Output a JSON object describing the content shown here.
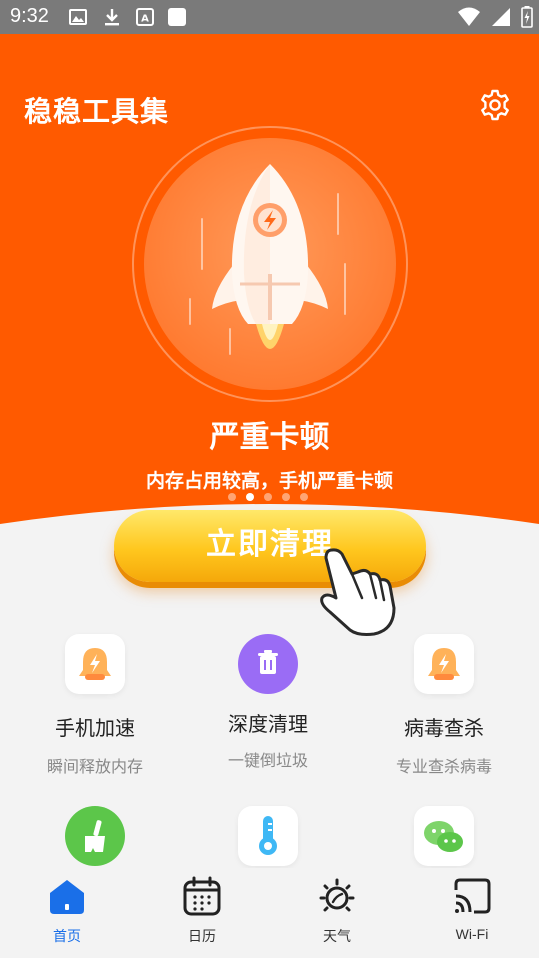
{
  "status_bar": {
    "time": "9:32"
  },
  "app": {
    "title": "稳稳工具集"
  },
  "hero": {
    "status_title": "严重卡顿",
    "status_desc": "内存占用较高，手机严重卡顿",
    "dots_total": 5,
    "dots_active": 2,
    "clean_button_label": "立即清理"
  },
  "tools": [
    {
      "name": "手机加速",
      "sub": "瞬间释放内存",
      "icon": "bell-bolt-icon"
    },
    {
      "name": "深度清理",
      "sub": "一键倒垃圾",
      "icon": "trash-icon"
    },
    {
      "name": "病毒查杀",
      "sub": "专业查杀病毒",
      "icon": "bell-bolt-icon"
    },
    {
      "name": "",
      "sub": "",
      "icon": "broom-icon"
    },
    {
      "name": "",
      "sub": "",
      "icon": "thermometer-icon"
    },
    {
      "name": "",
      "sub": "",
      "icon": "wechat-icon"
    }
  ],
  "nav": {
    "home": "首页",
    "calendar": "日历",
    "weather": "天气",
    "wifi": "Wi-Fi"
  },
  "colors": {
    "brand_orange": "#ff5a00",
    "button_yellow": "#ffc71e",
    "nav_active": "#1a6fe8"
  }
}
